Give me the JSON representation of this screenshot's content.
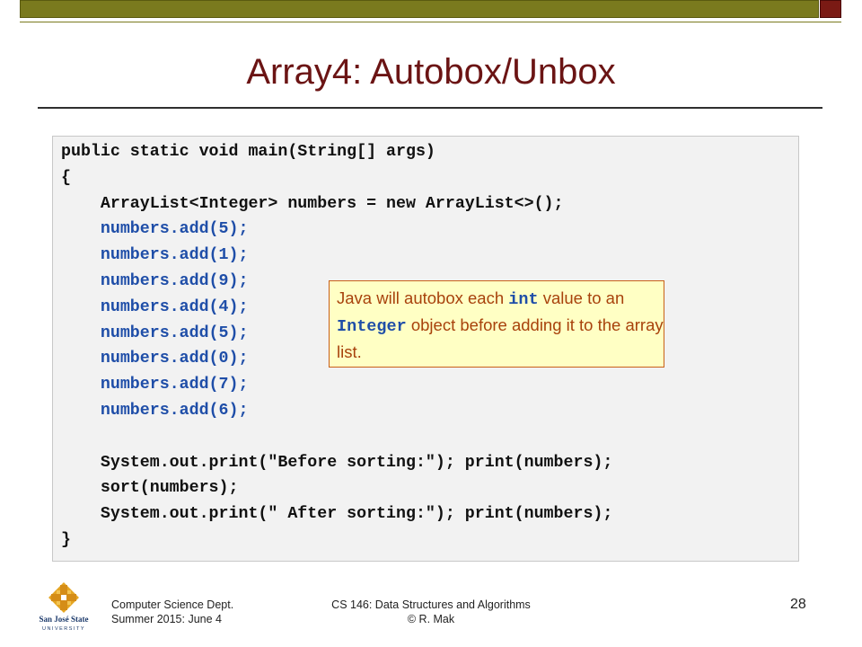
{
  "slide": {
    "title": "Array4: Autobox/Unbox",
    "page_number": "28"
  },
  "code": {
    "lines": [
      {
        "text": "public static void main(String[] args)",
        "color": "black"
      },
      {
        "text": "{",
        "color": "black"
      },
      {
        "text": "    ArrayList<Integer> numbers = new ArrayList<>();",
        "color": "black"
      },
      {
        "text": "    numbers.add(5);",
        "color": "blue"
      },
      {
        "text": "    numbers.add(1);",
        "color": "blue"
      },
      {
        "text": "    numbers.add(9);",
        "color": "blue"
      },
      {
        "text": "    numbers.add(4);",
        "color": "blue"
      },
      {
        "text": "    numbers.add(5);",
        "color": "blue"
      },
      {
        "text": "    numbers.add(0);",
        "color": "blue"
      },
      {
        "text": "    numbers.add(7);",
        "color": "blue"
      },
      {
        "text": "    numbers.add(6);",
        "color": "blue"
      },
      {
        "text": "",
        "color": "black"
      },
      {
        "text": "    System.out.print(\"Before sorting:\"); print(numbers);",
        "color": "black"
      },
      {
        "text": "    sort(numbers);",
        "color": "black"
      },
      {
        "text": "    System.out.print(\" After sorting:\"); print(numbers);",
        "color": "black"
      },
      {
        "text": "}",
        "color": "black"
      }
    ]
  },
  "callout": {
    "part1": "Java will autobox each ",
    "code1": "int",
    "part2": " value to an ",
    "code2": "Integer",
    "part3": " object before adding it to the array list."
  },
  "footer": {
    "left_line1": "Computer Science Dept.",
    "left_line2": "Summer 2015: June 4",
    "center_line1": "CS 146: Data Structures and Algorithms",
    "center_line2": "© R. Mak",
    "logo_text_line1": "San José State",
    "logo_text_line2": "UNIVERSITY"
  },
  "colors": {
    "title": "#6b1414",
    "code_blue": "#1f4ea8",
    "callout_bg": "#ffffc4",
    "callout_text": "#a8420c"
  }
}
